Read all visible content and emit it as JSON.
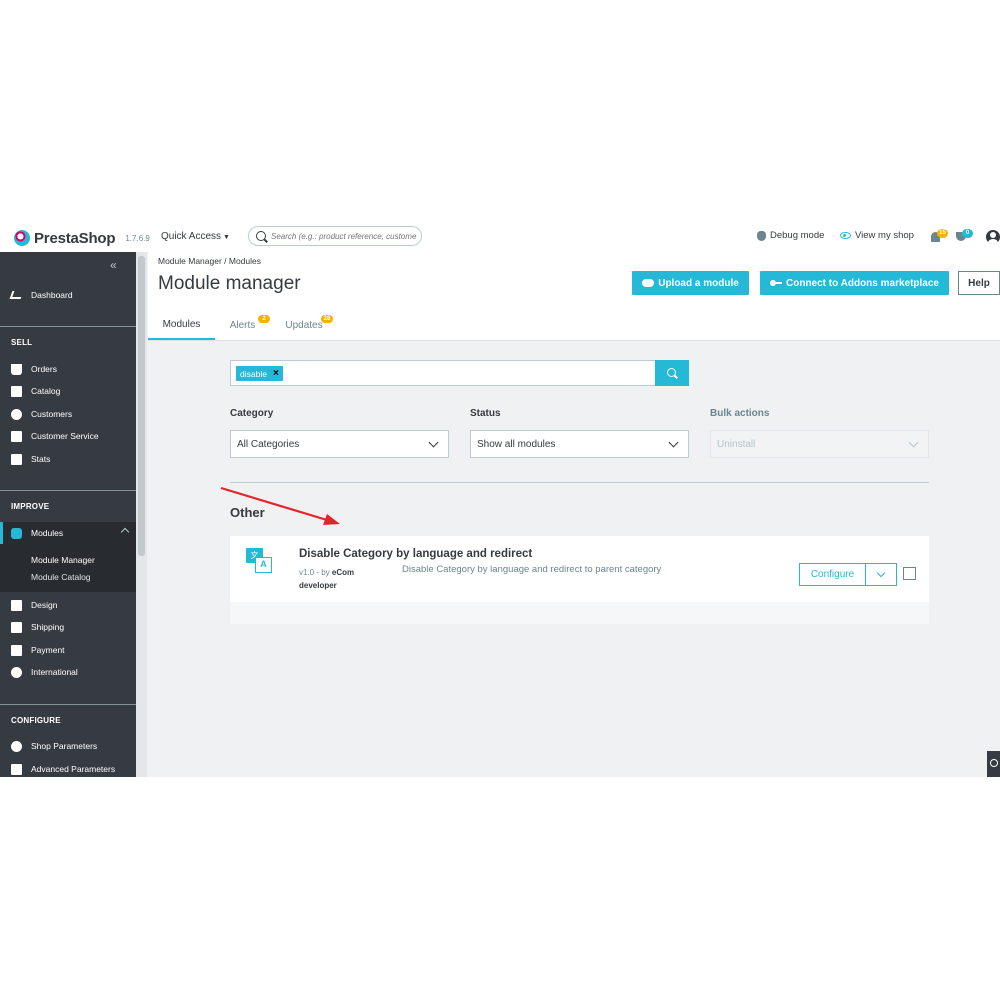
{
  "header": {
    "brand": "PrestaShop",
    "version": "1.7.6.9",
    "quick_access": "Quick Access",
    "search_placeholder": "Search (e.g.: product reference, custome",
    "debug_mode": "Debug mode",
    "view_shop": "View my shop",
    "notifications_count": "15",
    "trophy_count": "0"
  },
  "sidebar": {
    "collapse_glyph": "«",
    "dashboard": "Dashboard",
    "sell_heading": "SELL",
    "sell_items": [
      "Orders",
      "Catalog",
      "Customers",
      "Customer Service",
      "Stats"
    ],
    "improve_heading": "IMPROVE",
    "modules": "Modules",
    "modules_sub": [
      "Module Manager",
      "Module Catalog"
    ],
    "improve_items": [
      "Design",
      "Shipping",
      "Payment",
      "International"
    ],
    "configure_heading": "CONFIGURE",
    "configure_items": [
      "Shop Parameters",
      "Advanced Parameters"
    ]
  },
  "page": {
    "breadcrumb": "Module Manager  /  Modules",
    "title": "Module manager",
    "upload_button": "Upload a module",
    "connect_button": "Connect to Addons marketplace",
    "help_button": "Help",
    "tabs": [
      {
        "label": "Modules",
        "badge": ""
      },
      {
        "label": "Alerts",
        "badge": "2"
      },
      {
        "label": "Updates",
        "badge": "28"
      }
    ]
  },
  "filters": {
    "search_tag": "disable",
    "tag_remove": "×",
    "category_label": "Category",
    "category_value": "All Categories",
    "status_label": "Status",
    "status_value": "Show all modules",
    "bulk_label": "Bulk actions",
    "bulk_value": "Uninstall"
  },
  "modules_list": {
    "group_title": "Other",
    "module": {
      "icon_text_a": "文",
      "icon_text_b": "A",
      "name": "Disable Category by language and redirect",
      "version_prefix": "v1.0 - by ",
      "author": "eCom developer",
      "description": "Disable Category by language and redirect to parent category",
      "configure_button": "Configure"
    }
  },
  "colors": {
    "accent": "#25b9d7",
    "sidebar_bg": "#363a41",
    "annotation_arrow": "#e3252b",
    "badge": "#fab000"
  }
}
